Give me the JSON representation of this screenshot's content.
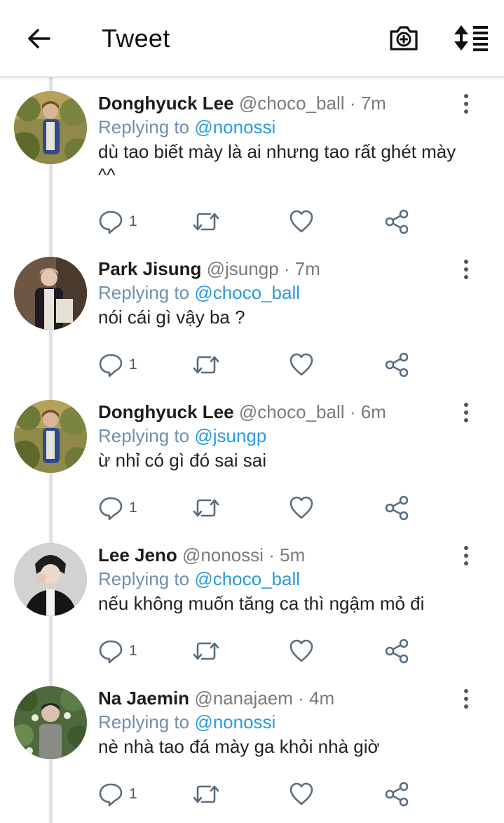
{
  "header": {
    "title": "Tweet",
    "back_icon": "arrow-left-icon",
    "camera_icon": "camera-plus-icon",
    "sort_icon": "sort-list-icon"
  },
  "tweets": [
    {
      "name": "Donghyuck Lee",
      "handle": "@choco_ball",
      "dot": "·",
      "time": "7m",
      "replying_prefix": "Replying to",
      "replying_to": "@nonossi",
      "text": "dù tao biết mày là ai nhưng tao rất ghét mày ^^",
      "reply_count": "1"
    },
    {
      "name": "Park Jisung",
      "handle": "@jsungp",
      "dot": "·",
      "time": "7m",
      "replying_prefix": "Replying to",
      "replying_to": "@choco_ball",
      "text": "nói cái gì vậy ba ?",
      "reply_count": "1"
    },
    {
      "name": "Donghyuck Lee",
      "handle": "@choco_ball",
      "dot": "·",
      "time": "6m",
      "replying_prefix": "Replying to",
      "replying_to": "@jsungp",
      "text": "ừ nhỉ có gì đó sai sai",
      "reply_count": "1"
    },
    {
      "name": "Lee Jeno",
      "handle": "@nonossi",
      "dot": "·",
      "time": "5m",
      "replying_prefix": "Replying to",
      "replying_to": "@choco_ball",
      "text": "nếu không muốn tăng ca thì ngậm mỏ đi",
      "reply_count": "1"
    },
    {
      "name": "Na Jaemin",
      "handle": "@nanajaem",
      "dot": "·",
      "time": "4m",
      "replying_prefix": "Replying to",
      "replying_to": "@nonossi",
      "text": "nè nhà tao đá mày ga khỏi nhà giờ",
      "reply_count": "1"
    }
  ],
  "colors": {
    "mention": "#2a9ae0",
    "handle": "#7a7a7a",
    "icon": "#5a6d80",
    "thread_line": "#e1e1e1"
  }
}
